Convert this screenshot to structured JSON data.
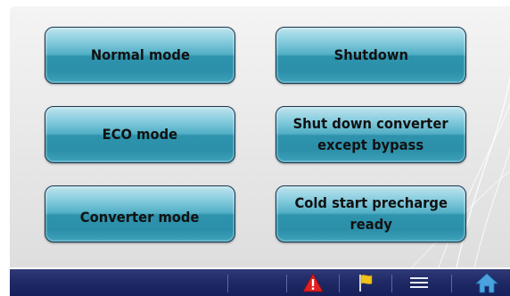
{
  "buttons": {
    "normal_mode": "Normal mode",
    "shutdown": "Shutdown",
    "eco_mode": "ECO mode",
    "shut_down_converter": "Shut down converter\nexcept bypass",
    "converter_mode": "Converter mode",
    "cold_start": "Cold start precharge\nready"
  },
  "taskbar": {
    "icons": [
      "alarm-warning-icon",
      "event-flag-icon",
      "menu-icon",
      "home-icon"
    ]
  },
  "colors": {
    "button_top": "#bfe4ee",
    "button_bottom": "#2b8fa9",
    "taskbar": "#1f2a66",
    "warning": "#e02020",
    "flag": "#f2c21b",
    "home": "#4aa3e0"
  }
}
